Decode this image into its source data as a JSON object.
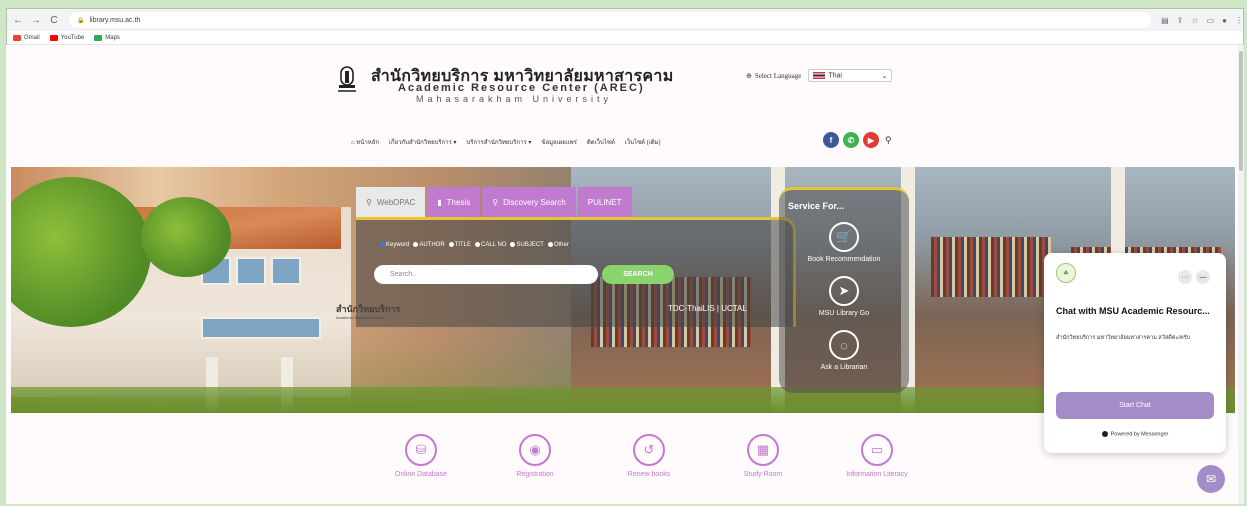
{
  "browser": {
    "url": "library.msu.ac.th",
    "bookmarks": [
      {
        "label": "Gmail",
        "color": "#ea4335"
      },
      {
        "label": "YouTube",
        "color": "#ff0000"
      },
      {
        "label": "Maps",
        "color": "#34a853"
      }
    ]
  },
  "header": {
    "title_th": "สำนักวิทยบริการ มหาวิทยาลัยมหาสารคาม",
    "title_en": "Academic Resource Center (AREC)",
    "title_en2": "Mahasarakham University",
    "select_language_label": "Select Language",
    "language_value": "Thai"
  },
  "menu": [
    "หน้าหลัก",
    "เกี่ยวกับสำนักวิทยบริการ ▾",
    "บริการสำนักวิทยบริการ ▾",
    "ข้อมูลเผยแพร่",
    "ติดเว็บไซต์",
    "เว็บไซต์ (เดิม)"
  ],
  "search": {
    "tabs": [
      "WebOPAC",
      "Thesis",
      "Discovery Search",
      "PULINET"
    ],
    "radio_options": [
      "Keyword",
      "AUTHOR",
      "TITLE",
      "CALL NO",
      "SUBJECT",
      "Other"
    ],
    "placeholder": "Search..",
    "button": "SEARCH",
    "links": "TDC-ThaiLIS  |  UCTAL"
  },
  "building_sign": {
    "line1": "สำนักวิทยบริการ",
    "line2": "Academic Resource Center"
  },
  "service": {
    "title": "Service For...",
    "items": [
      "Book Recommendation",
      "MSU Library Go",
      "Ask a Librarian"
    ]
  },
  "quick_links": [
    "Online Database",
    "Registration",
    "Renew books",
    "Study Room",
    "Information Literacy"
  ],
  "chat": {
    "title": "Chat with MSU Academic Resourc...",
    "message": "สำนักวิทยบริการ มหาวิทยาลัยมหาสารคาม สวัสดีค่ะ/ครับ",
    "button": "Start Chat",
    "powered": "Powered by Messenger"
  },
  "colors": {
    "accent_purple": "#c27ad0",
    "search_green": "#8bd36c",
    "gold_border": "#e7c535",
    "chat_button": "#a48cc9"
  }
}
